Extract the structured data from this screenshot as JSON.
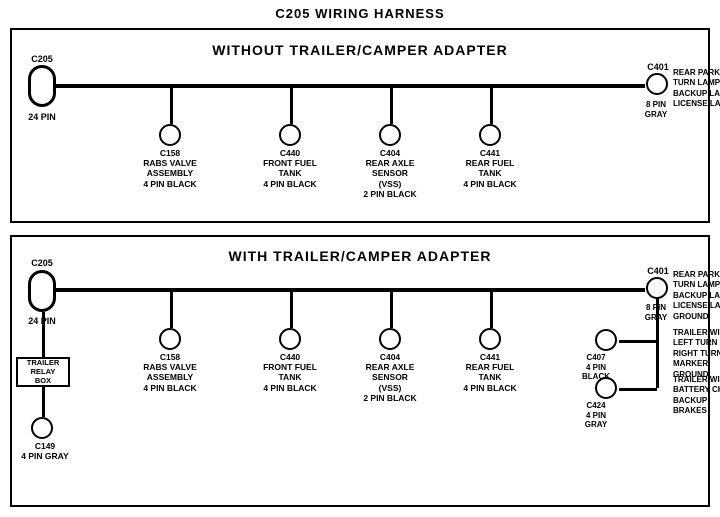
{
  "title": "C205 WIRING HARNESS",
  "top_section": {
    "label": "WITHOUT  TRAILER/CAMPER ADAPTER",
    "left_connector": {
      "id": "C205",
      "pin": "24 PIN"
    },
    "right_connector": {
      "id": "C401",
      "pin": "8 PIN",
      "color": "GRAY",
      "description": "REAR PARK/STOP\nTURN LAMPS\nBACKUP LAMPS\nLICENSE LAMPS"
    },
    "sub_connectors": [
      {
        "id": "C158",
        "desc": "RABS VALVE\nASSEMBLY\n4 PIN BLACK"
      },
      {
        "id": "C440",
        "desc": "FRONT FUEL\nTANK\n4 PIN BLACK"
      },
      {
        "id": "C404",
        "desc": "REAR AXLE\nSENSOR\n(VSS)\n2 PIN BLACK"
      },
      {
        "id": "C441",
        "desc": "REAR FUEL\nTANK\n4 PIN BLACK"
      }
    ]
  },
  "bottom_section": {
    "label": "WITH TRAILER/CAMPER ADAPTER",
    "left_connector": {
      "id": "C205",
      "pin": "24 PIN"
    },
    "right_connector": {
      "id": "C401",
      "pin": "8 PIN",
      "color": "GRAY",
      "description": "REAR PARK/STOP\nTURN LAMPS\nBACKUP LAMPS\nLICENSE LAMPS\nGROUND"
    },
    "trailer_relay": {
      "label": "TRAILER\nRELAY\nBOX"
    },
    "c149": {
      "id": "C149",
      "desc": "4 PIN GRAY"
    },
    "sub_connectors": [
      {
        "id": "C158",
        "desc": "RABS VALVE\nASSEMBLY\n4 PIN BLACK"
      },
      {
        "id": "C440",
        "desc": "FRONT FUEL\nTANK\n4 PIN BLACK"
      },
      {
        "id": "C404",
        "desc": "REAR AXLE\nSENSOR\n(VSS)\n2 PIN BLACK"
      },
      {
        "id": "C441",
        "desc": "REAR FUEL\nTANK\n4 PIN BLACK"
      }
    ],
    "right_side_connectors": [
      {
        "id": "C407",
        "desc": "4 PIN\nBLACK",
        "label": "TRAILER WIRES\nLEFT TURN\nRIGHT TURN\nMARKER\nGROUND"
      },
      {
        "id": "C424",
        "desc": "4 PIN\nGRAY",
        "label": "TRAILER WIRES\nBATTERY CHARGE\nBACKUP\nBRAKES"
      }
    ]
  }
}
